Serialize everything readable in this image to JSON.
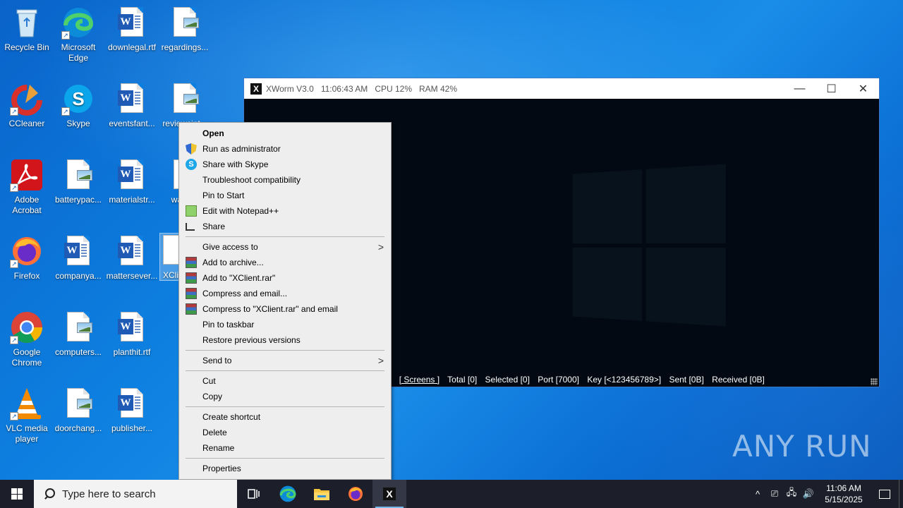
{
  "desktop": {
    "icons": [
      {
        "label": "Recycle Bin",
        "icon": "recycle-bin-icon"
      },
      {
        "label": "Microsoft Edge",
        "icon": "edge-icon"
      },
      {
        "label": "downlegal.rtf",
        "icon": "word-doc-icon"
      },
      {
        "label": "regardings...",
        "icon": "image-file-icon"
      },
      {
        "label": "CCleaner",
        "icon": "ccleaner-icon"
      },
      {
        "label": "Skype",
        "icon": "skype-icon"
      },
      {
        "label": "eventsfant...",
        "icon": "word-doc-icon"
      },
      {
        "label": "reviewsint...",
        "icon": "image-file-icon"
      },
      {
        "label": "Adobe Acrobat",
        "icon": "acrobat-icon"
      },
      {
        "label": "batterypac...",
        "icon": "image-file-icon"
      },
      {
        "label": "materialstr...",
        "icon": "word-doc-icon"
      },
      {
        "label": "warni...",
        "icon": "file-icon"
      },
      {
        "label": "Firefox",
        "icon": "firefox-icon"
      },
      {
        "label": "companya...",
        "icon": "word-doc-icon"
      },
      {
        "label": "mattersever...",
        "icon": "word-doc-icon"
      },
      {
        "label": "XCli...",
        "icon": "file-icon"
      },
      {
        "label": "Google Chrome",
        "icon": "chrome-icon"
      },
      {
        "label": "computers...",
        "icon": "image-file-icon"
      },
      {
        "label": "planthit.rtf",
        "icon": "word-doc-icon"
      },
      {
        "label": "VLC media player",
        "icon": "vlc-icon"
      },
      {
        "label": "doorchang...",
        "icon": "image-file-icon"
      },
      {
        "label": "publisher...",
        "icon": "word-doc-icon"
      }
    ]
  },
  "xworm": {
    "logo": "X",
    "title": "XWorm V3.0",
    "time": "11:06:43 AM",
    "cpu": "CPU 12%",
    "ram": "RAM 42%",
    "minimize": "—",
    "maximize": "☐",
    "close": "✕",
    "status": {
      "left": "]",
      "screens": "[ Screens ]",
      "total": "Total [0]",
      "selected": "Selected [0]",
      "port": "Port [7000]",
      "key": "Key [<123456789>]",
      "sent": "Sent [0B]",
      "received": "Received [0B]"
    }
  },
  "context_menu": {
    "groups": [
      [
        {
          "label": "Open",
          "bold": true,
          "icon": ""
        },
        {
          "label": "Run as administrator",
          "icon": "uac-shield-icon"
        },
        {
          "label": "Share with Skype",
          "icon": "skype-icon"
        },
        {
          "label": "Troubleshoot compatibility",
          "icon": ""
        },
        {
          "label": "Pin to Start",
          "icon": ""
        },
        {
          "label": "Edit with Notepad++",
          "icon": "notepad-plus-plus-icon"
        },
        {
          "label": "Share",
          "icon": "share-icon"
        }
      ],
      [
        {
          "label": "Give access to",
          "icon": "",
          "submenu": true
        },
        {
          "label": "Add to archive...",
          "icon": "winrar-icon"
        },
        {
          "label": "Add to \"XClient.rar\"",
          "icon": "winrar-icon"
        },
        {
          "label": "Compress and email...",
          "icon": "winrar-icon"
        },
        {
          "label": "Compress to \"XClient.rar\" and email",
          "icon": "winrar-icon"
        },
        {
          "label": "Pin to taskbar",
          "icon": ""
        },
        {
          "label": "Restore previous versions",
          "icon": ""
        }
      ],
      [
        {
          "label": "Send to",
          "icon": "",
          "submenu": true
        }
      ],
      [
        {
          "label": "Cut",
          "icon": ""
        },
        {
          "label": "Copy",
          "icon": ""
        }
      ],
      [
        {
          "label": "Create shortcut",
          "icon": ""
        },
        {
          "label": "Delete",
          "icon": ""
        },
        {
          "label": "Rename",
          "icon": ""
        }
      ],
      [
        {
          "label": "Properties",
          "icon": ""
        }
      ]
    ],
    "submenu_arrow": ">"
  },
  "taskbar": {
    "search_placeholder": "Type here to search",
    "apps": [
      "task-view-icon",
      "edge-icon",
      "file-explorer-icon",
      "firefox-icon",
      "xworm-icon"
    ],
    "xworm_label": "X",
    "clock_time": "11:06 AM",
    "clock_date": "5/15/2025",
    "tray_chevron": "^"
  },
  "watermark": "ANY RUN",
  "colors": {
    "desktop": "#0d7fe0",
    "taskbar": "#1c1f2a",
    "menu": "#eeeeee",
    "xworm_bg": "#020912"
  }
}
